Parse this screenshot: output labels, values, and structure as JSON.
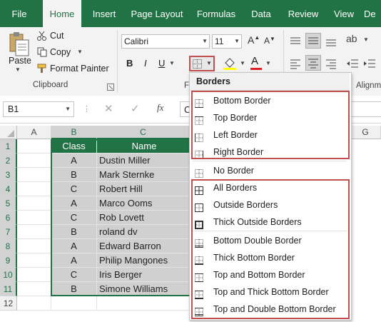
{
  "tabs": [
    "File",
    "Home",
    "Insert",
    "Page Layout",
    "Formulas",
    "Data",
    "Review",
    "View",
    "De"
  ],
  "clipboard": {
    "paste_label": "Paste",
    "cut_label": "Cut",
    "copy_label": "Copy",
    "format_painter_label": "Format Painter",
    "group_label": "Clipboard"
  },
  "font": {
    "name": "Calibri",
    "size": "11",
    "group_label_partial": "F"
  },
  "alignment": {
    "group_label_partial": "Alignm"
  },
  "name_box": {
    "value": "B1"
  },
  "formula_bar": {
    "fx_label": "fx",
    "partial_text": "C"
  },
  "columns": [
    "A",
    "B",
    "C",
    "G"
  ],
  "rows": [
    "1",
    "2",
    "3",
    "4",
    "5",
    "6",
    "7",
    "8",
    "9",
    "10",
    "11",
    "12"
  ],
  "table": {
    "headers": [
      "Class",
      "Name"
    ],
    "rows": [
      [
        "A",
        "Dustin Miller"
      ],
      [
        "B",
        "Mark Sternke"
      ],
      [
        "C",
        "Robert Hill"
      ],
      [
        "A",
        "Marco Ooms"
      ],
      [
        "C",
        "Rob Lovett"
      ],
      [
        "B",
        "roland dv"
      ],
      [
        "A",
        "Edward Barron"
      ],
      [
        "A",
        "Philip Mangones"
      ],
      [
        "C",
        "Iris Berger"
      ],
      [
        "B",
        "Simone Williams"
      ]
    ]
  },
  "borders_menu": {
    "title": "Borders",
    "items": [
      "Bottom Border",
      "Top Border",
      "Left Border",
      "Right Border",
      "No Border",
      "All Borders",
      "Outside Borders",
      "Thick Outside Borders",
      "Bottom Double Border",
      "Thick Bottom Border",
      "Top and Bottom Border",
      "Top and Thick Bottom Border",
      "Top and Double Bottom Border"
    ]
  },
  "colors": {
    "excel_green": "#217346",
    "header_fill": "#217346",
    "selection_fill": "#d0d0d0",
    "highlight_red": "#c0504d",
    "font_color_bar": "#e02020"
  }
}
